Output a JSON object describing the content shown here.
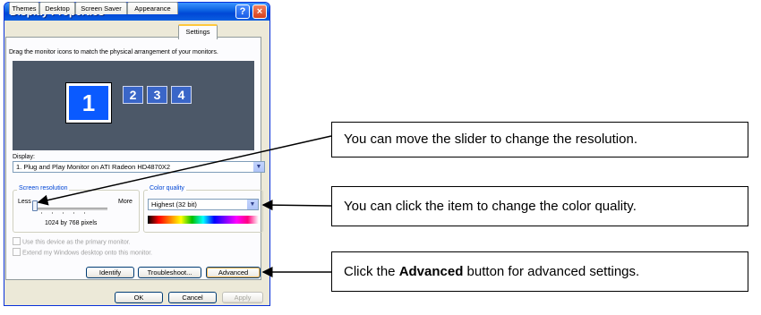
{
  "window": {
    "title": "Display Properties",
    "help_glyph": "?",
    "close_glyph": "×"
  },
  "tabs": [
    {
      "label": "Themes"
    },
    {
      "label": "Desktop"
    },
    {
      "label": "Screen Saver"
    },
    {
      "label": "Appearance"
    },
    {
      "label": "Settings",
      "active": true
    }
  ],
  "settings": {
    "instruction": "Drag the monitor icons to match the physical arrangement of your monitors.",
    "monitors": [
      "1",
      "2",
      "3",
      "4"
    ],
    "display_label": "Display:",
    "display_value": "1. Plug and Play Monitor on ATI Radeon HD4870X2",
    "screen_resolution": {
      "title": "Screen resolution",
      "less": "Less",
      "more": "More",
      "value": "1024 by 768 pixels",
      "slider_level": 0.05
    },
    "color_quality": {
      "title": "Color quality",
      "value": "Highest (32 bit)"
    },
    "checkbox_primary": "Use this device as the primary monitor.",
    "checkbox_extend": "Extend my Windows desktop onto this monitor.",
    "buttons": {
      "identify": "Identify",
      "troubleshoot": "Troubleshoot...",
      "advanced": "Advanced"
    }
  },
  "footer_buttons": {
    "ok": "OK",
    "cancel": "Cancel",
    "apply": "Apply"
  },
  "callouts": {
    "slider": "You can move the slider to change the resolution.",
    "color": "You can click the item to change the color quality.",
    "advanced_pre": "Click the ",
    "advanced_bold": "Advanced",
    "advanced_post": " button for advanced settings."
  }
}
